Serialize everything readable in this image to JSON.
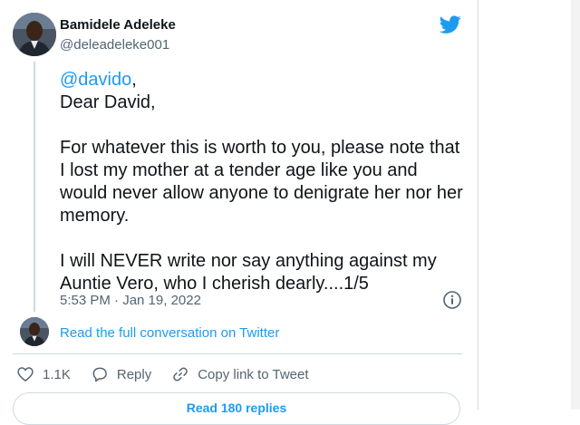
{
  "author": {
    "name": "Bamidele Adeleke",
    "handle": "@deleadeleke001"
  },
  "tweet": {
    "mention": "@davido",
    "mention_suffix": ",",
    "salutation": "Dear David,",
    "paragraph1": "For whatever this is worth to you, please note that I lost my mother at a tender age like you and would never allow anyone to denigrate her nor her memory.",
    "paragraph2": "I will NEVER write nor say anything against my Auntie Vero, who I cherish dearly....1/5",
    "timestamp": "5:53 PM · Jan 19, 2022"
  },
  "conversation_link": "Read the full conversation on Twitter",
  "actions": {
    "likes": "1.1K",
    "reply": "Reply",
    "copy_link": "Copy link to Tweet"
  },
  "read_replies": "Read 180 replies",
  "colors": {
    "accent": "#1d9bf0",
    "muted": "#536471",
    "border": "#cfd9de",
    "text": "#0f1419"
  },
  "icons": [
    "twitter-bird-icon",
    "info-icon",
    "heart-icon",
    "reply-icon",
    "link-icon"
  ]
}
